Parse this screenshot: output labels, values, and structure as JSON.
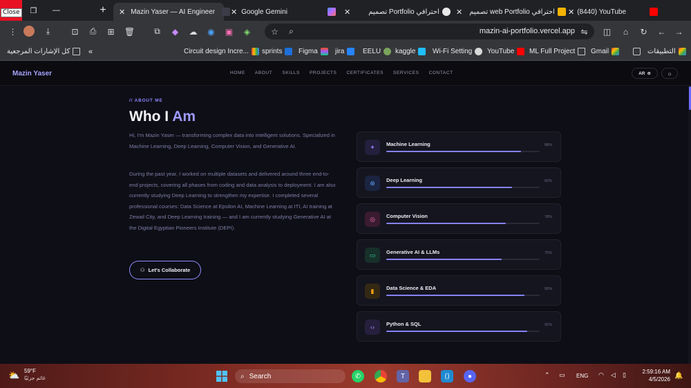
{
  "browser": {
    "close_tooltip": "Close",
    "tabs": [
      {
        "title": "Mazin Yaser — AI Engineer",
        "active": true
      },
      {
        "title": "Google Gemini",
        "active": false
      },
      {
        "title": "تصميم Portfolio احترافي",
        "active": false
      },
      {
        "title": "تصميم web Portfolio احترافي",
        "active": false
      },
      {
        "title": "(8440) YouTube",
        "active": false
      }
    ],
    "url": "mazin-ai-portfolio.vercel.app"
  },
  "bookmarks": {
    "left_folder": "كل الإشارات المرجعية",
    "items": [
      "Circuit design Incre...",
      "sprints",
      "Figma",
      "jira",
      "EELU",
      "kaggle",
      "Wi-Fi Setting",
      "YouTube",
      "ML Full Project",
      "Gmail"
    ],
    "apps": "التطبيقات"
  },
  "site": {
    "logo": "Mazin Yaser",
    "nav": [
      "HOME",
      "ABOUT",
      "SKILLS",
      "PROJECTS",
      "CERTIFICATES",
      "SERVICES",
      "CONTACT"
    ],
    "lang": "AR"
  },
  "about": {
    "eyebrow": "// ABOUT ME",
    "heading_part1": "Who I ",
    "heading_part2": "Am",
    "para1": "Hi, I'm Mazin Yaser — transforming complex data into intelligent solutions. Specialized in Machine Learning, Deep Learning, Computer Vision, and Generative AI.",
    "para2": "During the past year, I worked on multiple datasets and delivered around three end-to-end projects, covering all phases from coding and data analysis to deployment. I am also currently studying Deep Learning to strengthen my expertise. I completed several professional courses: Data Science at Epsilon AI, Machine Learning at ITI, AI training at Zewail City, and Deep Learning training — and I am currently studying Generative AI at the Digital Egyptian Pioneers Institute (DEPI).",
    "cta": "Let's Collaborate"
  },
  "skills": [
    {
      "name": "Machine Learning",
      "percent_label": "88%",
      "level": 0.88,
      "icon": "lightbulb-icon",
      "color": "#8b7cf6",
      "bg": "#241f3d"
    },
    {
      "name": "Deep Learning",
      "percent_label": "82%",
      "level": 0.82,
      "icon": "network-icon",
      "color": "#60a5fa",
      "bg": "#1b2440"
    },
    {
      "name": "Computer Vision",
      "percent_label": "78%",
      "level": 0.78,
      "icon": "eye-icon",
      "color": "#f472b6",
      "bg": "#3a1b30"
    },
    {
      "name": "Generative AI & LLMs",
      "percent_label": "75%",
      "level": 0.75,
      "icon": "monitor-icon",
      "color": "#34d399",
      "bg": "#17302a"
    },
    {
      "name": "Data Science & EDA",
      "percent_label": "90%",
      "level": 0.9,
      "icon": "bar-chart-icon",
      "color": "#f59e0b",
      "bg": "#332814"
    },
    {
      "name": "Python & SQL",
      "percent_label": "92%",
      "level": 0.92,
      "icon": "code-icon",
      "color": "#a78bfa",
      "bg": "#261f3d"
    }
  ],
  "taskbar": {
    "temp": "59°F",
    "weather_text": "غائم جزئيًا",
    "search": "Search",
    "lang": "ENG",
    "time": "2:59:16 AM",
    "date": "4/5/2026"
  }
}
